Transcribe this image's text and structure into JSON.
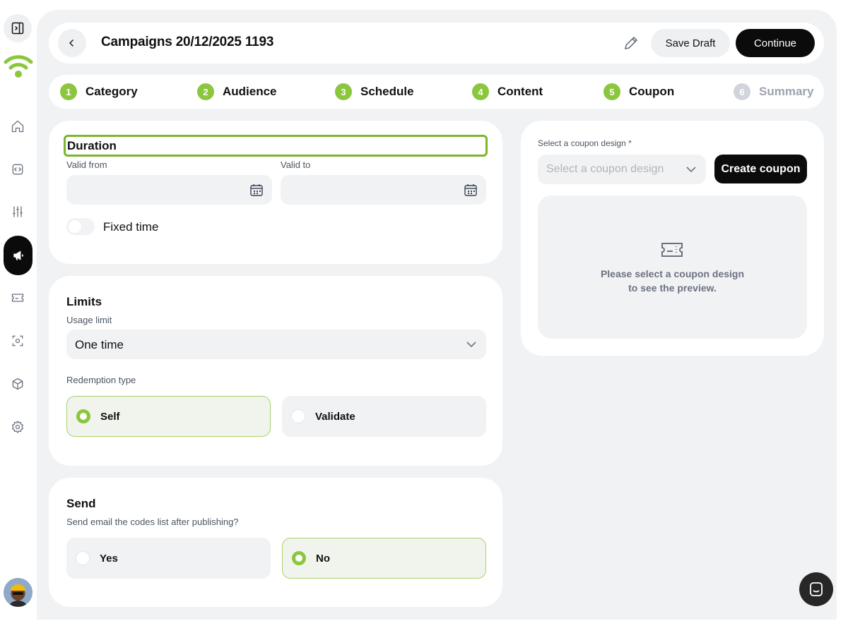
{
  "header": {
    "title": "Campaigns 20/12/2025 1193",
    "save_draft": "Save Draft",
    "continue": "Continue"
  },
  "steps": [
    {
      "num": "1",
      "label": "Category",
      "state": "done"
    },
    {
      "num": "2",
      "label": "Audience",
      "state": "done"
    },
    {
      "num": "3",
      "label": "Schedule",
      "state": "done"
    },
    {
      "num": "4",
      "label": "Content",
      "state": "done"
    },
    {
      "num": "5",
      "label": "Coupon",
      "state": "current"
    },
    {
      "num": "6",
      "label": "Summary",
      "state": "inactive"
    }
  ],
  "duration": {
    "title": "Duration",
    "valid_from_label": "Valid from",
    "valid_to_label": "Valid to",
    "valid_from_value": "",
    "valid_to_value": "",
    "fixed_time_label": "Fixed time",
    "fixed_time_on": false
  },
  "limits": {
    "title": "Limits",
    "usage_limit_label": "Usage limit",
    "usage_limit_value": "One time",
    "redemption_label": "Redemption type",
    "options": [
      "Self",
      "Validate"
    ],
    "selected": "Self"
  },
  "send": {
    "title": "Send",
    "question": "Send email the codes list after publishing?",
    "options": [
      "Yes",
      "No"
    ],
    "selected": "No"
  },
  "coupon": {
    "label": "Select a coupon design *",
    "placeholder": "Select a coupon design",
    "create_button": "Create coupon",
    "preview_line1": "Please select a coupon design",
    "preview_line2": "to see the preview."
  },
  "sidebar": {
    "items": [
      "toggle-sidebar",
      "home",
      "code",
      "sliders",
      "campaigns",
      "coupons",
      "scan",
      "products",
      "settings"
    ],
    "active": "campaigns"
  },
  "colors": {
    "accent": "#8cc63f",
    "primary_button": "#0b0b0b",
    "background": "#f1f2f4"
  }
}
